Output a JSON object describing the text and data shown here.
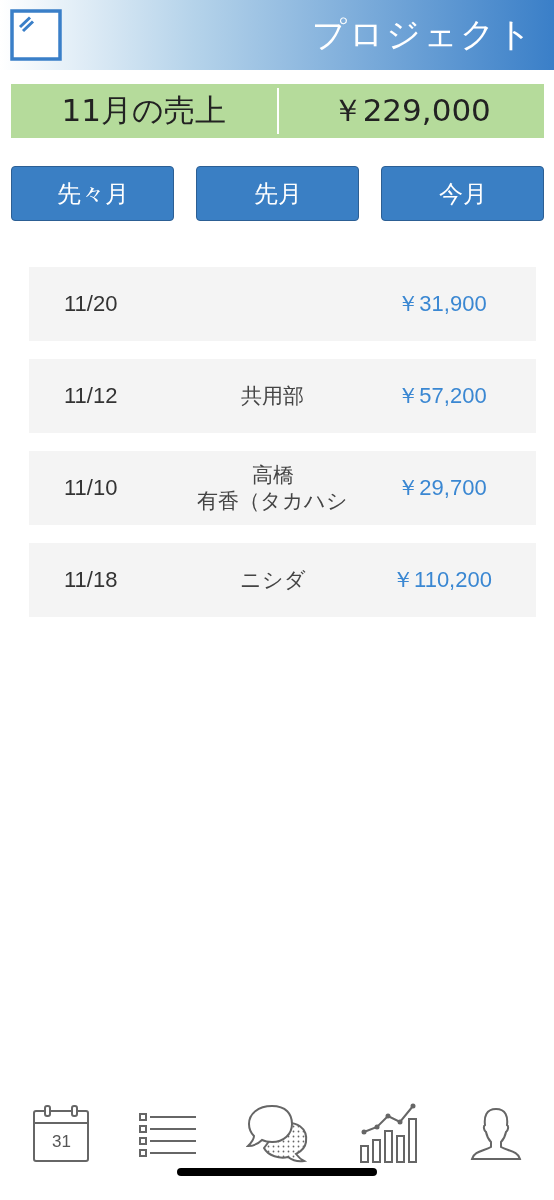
{
  "header": {
    "title": "プロジェクト"
  },
  "summary": {
    "label": "11月の売上",
    "amount": "￥229,000"
  },
  "period_buttons": [
    "先々月",
    "先月",
    "今月"
  ],
  "entries": [
    {
      "date": "11/20",
      "amount": "￥31,900"
    },
    {
      "date": "11/12",
      "name_lines": [
        "共用部"
      ],
      "amount": "￥57,200"
    },
    {
      "date": "11/10",
      "name_lines": [
        "高橋",
        "有香（タカハシ"
      ],
      "amount": "￥29,700"
    },
    {
      "date": "11/18",
      "name_lines": [
        "ニシダ"
      ],
      "amount": "￥110,200"
    }
  ],
  "tab_bar": {
    "calendar_day": "31"
  }
}
